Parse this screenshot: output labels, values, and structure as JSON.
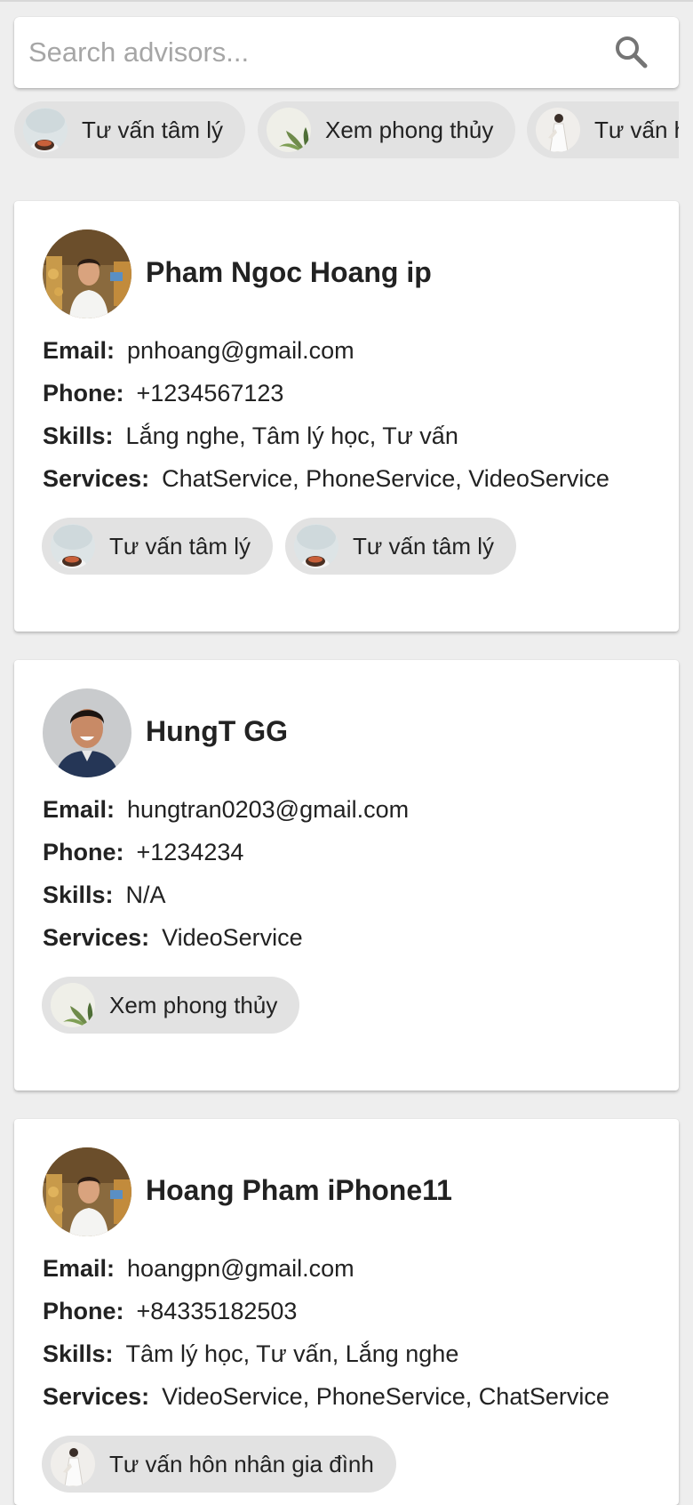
{
  "search": {
    "placeholder": "Search advisors..."
  },
  "categories": [
    {
      "label": "Tư vấn tâm lý",
      "icon": "cup-thumbnail"
    },
    {
      "label": "Xem phong thủy",
      "icon": "plant-thumbnail"
    },
    {
      "label": "Tư vấn h",
      "icon": "bride-thumbnail"
    }
  ],
  "field_labels": {
    "email": "Email:",
    "phone": "Phone:",
    "skills": "Skills:",
    "services": "Services:"
  },
  "advisors": [
    {
      "name": "Pham Ngoc Hoang ip",
      "email": "pnhoang@gmail.com",
      "phone": "+1234567123",
      "skills": "Lắng nghe, Tâm lý học, Tư vấn",
      "services": "ChatService, PhoneService, VideoService",
      "tags": [
        "Tư vấn tâm lý",
        "Tư vấn tâm lý"
      ]
    },
    {
      "name": "HungT GG",
      "email": "hungtran0203@gmail.com",
      "phone": "+1234234",
      "skills": "N/A",
      "services": "VideoService",
      "tags": [
        "Xem phong thủy"
      ]
    },
    {
      "name": "Hoang Pham iPhone11",
      "email": "hoangpn@gmail.com",
      "phone": "+84335182503",
      "skills": "Tâm lý học, Tư vấn, Lắng nghe",
      "services": "VideoService, PhoneService, ChatService",
      "tags": [
        "Tư vấn hôn nhân gia đình"
      ]
    }
  ]
}
